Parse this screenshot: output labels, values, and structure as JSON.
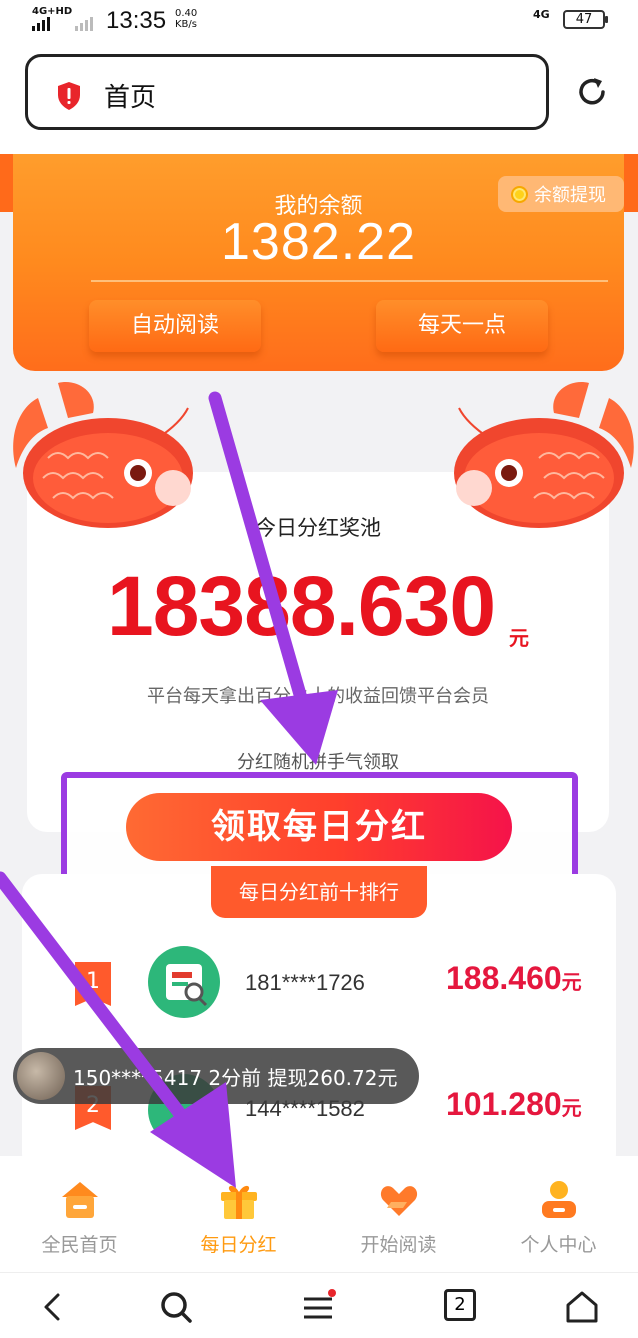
{
  "status_bar": {
    "network_left": "4G+HD",
    "time": "13:35",
    "speed_value": "0.40",
    "speed_unit": "KB/s",
    "network_right": "4G",
    "battery": "47"
  },
  "browser": {
    "url_text": "首页",
    "security_icon": "shield-alert-icon",
    "refresh_icon": "refresh-icon"
  },
  "balance": {
    "label": "我的余额",
    "value": "1382.22",
    "withdraw_label": "余额提现",
    "auto_read_label": "自动阅读",
    "daily_label": "每天一点"
  },
  "pool": {
    "title": "今日分红奖池",
    "amount": "18388.630",
    "unit": "元",
    "description": "平台每天拿出百分之十的收益回馈平台会员",
    "subtext": "分红随机拼手气领取",
    "claim_label": "领取每日分红"
  },
  "ranking": {
    "tab_label": "每日分红前十排行",
    "rows": [
      {
        "rank": "1",
        "phone": "181****1726",
        "amount": "188.460",
        "unit": "元"
      },
      {
        "rank": "2",
        "phone": "144****1582",
        "amount": "101.280",
        "unit": "元"
      }
    ]
  },
  "toast": {
    "text": "150****5417 2分前 提现260.72元"
  },
  "tabbar": {
    "items": [
      {
        "label": "全民首页",
        "icon": "home-icon",
        "active": false
      },
      {
        "label": "每日分红",
        "icon": "gift-icon",
        "active": true
      },
      {
        "label": "开始阅读",
        "icon": "heart-icon",
        "active": false
      },
      {
        "label": "个人中心",
        "icon": "person-icon",
        "active": false
      }
    ]
  },
  "system_nav": {
    "tabs_count": "2"
  },
  "colors": {
    "orange": "#ff8a1e",
    "red": "#e8141f",
    "purple_annotation": "#9b3be2",
    "active_tab": "#ff9a10"
  }
}
